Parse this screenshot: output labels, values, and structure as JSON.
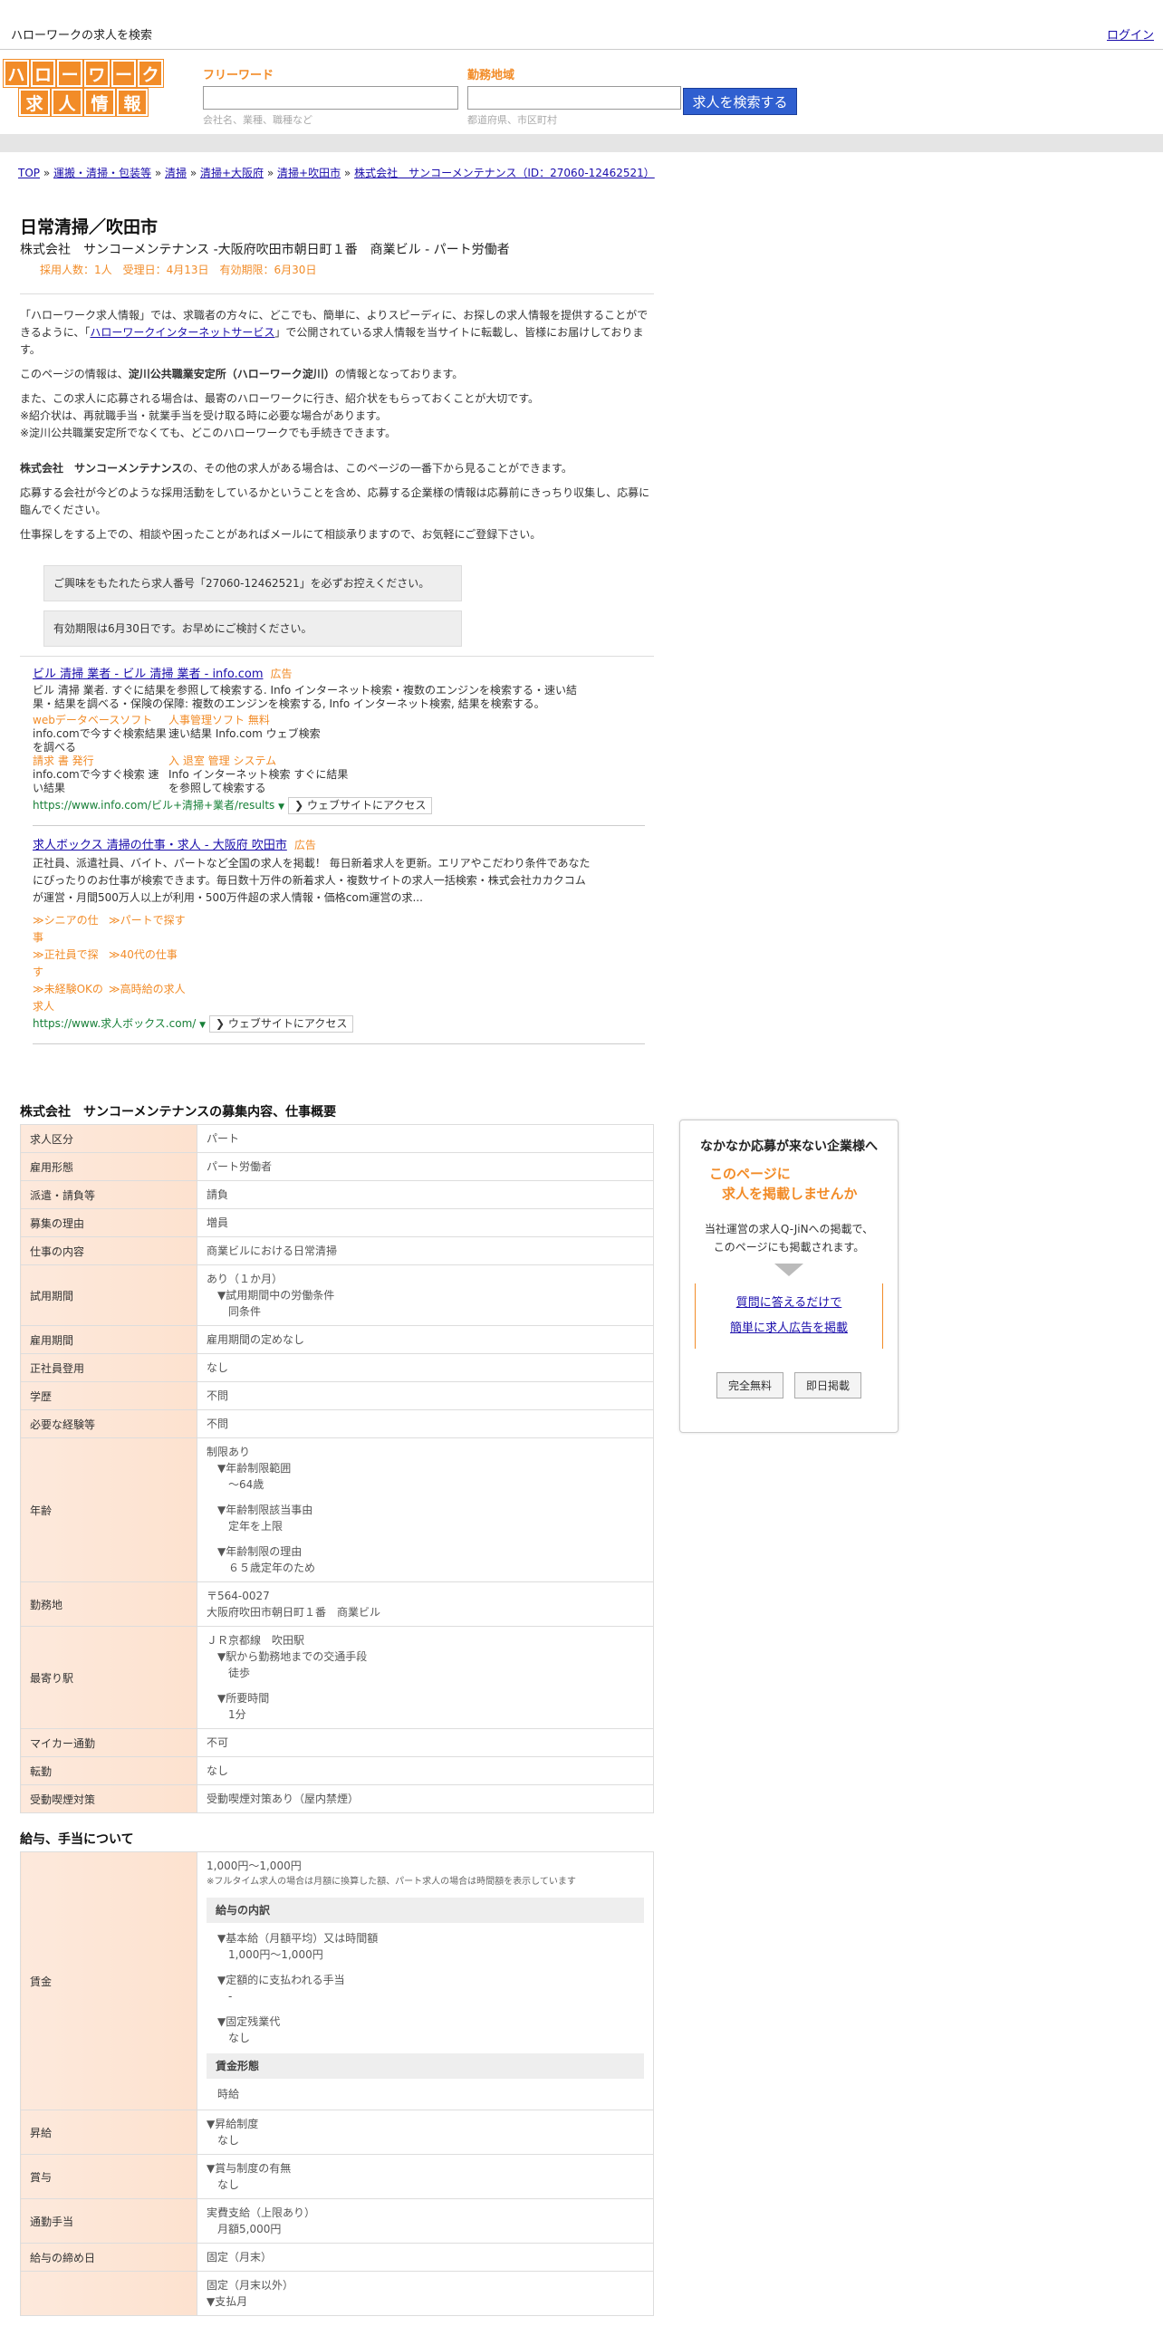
{
  "topbar": {
    "site_title": "ハローワークの求人を検索",
    "login": "ログイン"
  },
  "logo": {
    "row1": [
      "ハ",
      "ロ",
      "ー",
      "ワ",
      "ー",
      "ク"
    ],
    "row2": [
      "求",
      "人",
      "情",
      "報"
    ]
  },
  "search": {
    "freeword_label": "フリーワード",
    "freeword_hint": "会社名、業種、職種など",
    "area_label": "勤務地域",
    "area_hint": "都道府県、市区町村",
    "button": "求人を検索する"
  },
  "breadcrumb": [
    "TOP",
    "運搬・清掃・包装等",
    "清掃",
    "清掃+大阪府",
    "清掃+吹田市",
    "株式会社　サンコーメンテナンス（ID：27060-12462521）"
  ],
  "job": {
    "title": "日常清掃／吹田市",
    "company_line": "株式会社　サンコーメンテナンス -大阪府吹田市朝日町１番　商業ビル - パート労働者",
    "meta": "採用人数：1人　受理日：4月13日　有効期限：6月30日"
  },
  "intro": {
    "p1_a": "「ハローワーク求人情報」では、求職者の方々に、どこでも、簡単に、よりスピーディに、お探しの求人情報を提供することができるように、「",
    "p1_link": "ハローワークインターネットサービス",
    "p1_b": "」で公開されている求人情報を当サイトに転載し、皆様にお届けしております。",
    "p2_a": "このページの情報は、",
    "p2_bold": "淀川公共職業安定所（ハローワーク淀川）",
    "p2_b": "の情報となっております。",
    "p3": [
      "また、この求人に応募される場合は、最寄のハローワークに行き、紹介状をもらっておくことが大切です。",
      "※紹介状は、再就職手当・就業手当を受け取る時に必要な場合があります。",
      "※淀川公共職業安定所でなくても、どこのハローワークでも手続きできます。"
    ],
    "p4_bold": "株式会社　サンコーメンテナンス",
    "p4_b": "の、その他の求人がある場合は、このページの一番下から見ることができます。",
    "p5": "応募する会社が今どのような採用活動をしているかということを含め、応募する企業様の情報は応募前にきっちり収集し、応募に臨んでください。",
    "p6": "仕事探しをする上での、相談や困ったことがあればメールにて相談承りますので、お気軽にご登録下さい。",
    "box1": "ご興味をもたれたら求人番号「27060-12462521」を必ずお控えください。",
    "box2": "有効期限は6月30日です。お早めにご検討ください。"
  },
  "ads": [
    {
      "title": "ビル 清掃 業者 - ビル 清掃 業者 - info.com",
      "badge": "広告",
      "body": "ビル 清掃 業者. すぐに結果を参照して検索する. Info インターネット検索・複数のエンジンを検索する・速い結果・結果を調べる・保険の保障: 複数のエンジンを検索する, Info インターネット検索, 結果を検索する。",
      "links": [
        {
          "title": "webデータベースソフト",
          "desc": "info.comで今すぐ検索結果を調べる"
        },
        {
          "title": "人事管理ソフト 無料",
          "desc": "速い結果 Info.com ウェブ検索"
        },
        {
          "title": "請求 書 発行",
          "desc": "info.comで今すぐ検索 速い結果"
        },
        {
          "title": "入 退室 管理 システム",
          "desc": "Info インターネット検索 すぐに結果を参照して検索する"
        }
      ],
      "url": "https://www.info.com/ビル+清掃+業者/results",
      "visit": "ウェブサイトにアクセス"
    },
    {
      "title": "求人ボックス 清掃の仕事・求人 - 大阪府 吹田市",
      "badge": "広告",
      "body": "正社員、派遣社員、バイト、パートなど全国の求人を掲載！ 毎日新着求人を更新。エリアやこだわり条件であなたにぴったりのお仕事が検索できます。毎日数十万件の新着求人・複数サイトの求人一括検索・株式会社カカクコムが運営・月間500万人以上が利用・500万件超の求人情報・価格com運営の求...",
      "links": [
        {
          "title": "≫シニアの仕事",
          "desc": ""
        },
        {
          "title": "≫パートで探す",
          "desc": ""
        },
        {
          "title": "≫正社員で探す",
          "desc": ""
        },
        {
          "title": "≫40代の仕事",
          "desc": ""
        },
        {
          "title": "≫未経験OKの求人",
          "desc": ""
        },
        {
          "title": "≫高時給の求人",
          "desc": ""
        }
      ],
      "url": "https://www.求人ボックス.com/",
      "visit": "ウェブサイトにアクセス"
    }
  ],
  "overview": {
    "title": "株式会社　サンコーメンテナンスの募集内容、仕事概要",
    "rows": [
      {
        "k": "求人区分",
        "v": [
          "パート"
        ]
      },
      {
        "k": "雇用形態",
        "v": [
          "パート労働者"
        ]
      },
      {
        "k": "派遣・請負等",
        "v": [
          "請負"
        ]
      },
      {
        "k": "募集の理由",
        "v": [
          "増員"
        ]
      },
      {
        "k": "仕事の内容",
        "v": [
          "商業ビルにおける日常清掃"
        ]
      },
      {
        "k": "試用期間",
        "v": [
          "あり（１か月）",
          "▼試用期間中の労働条件",
          "同条件"
        ]
      },
      {
        "k": "雇用期間",
        "v": [
          "雇用期間の定めなし"
        ]
      },
      {
        "k": "正社員登用",
        "v": [
          "なし"
        ]
      },
      {
        "k": "学歴",
        "v": [
          "不問"
        ]
      },
      {
        "k": "必要な経験等",
        "v": [
          "不問"
        ]
      },
      {
        "k": "年齢",
        "v": [
          "制限あり",
          "▼年齢制限範囲",
          "〜64歳",
          "",
          "▼年齢制限該当事由",
          "定年を上限",
          "",
          "▼年齢制限の理由",
          "６５歳定年のため"
        ]
      },
      {
        "k": "勤務地",
        "v": [
          "〒564-0027",
          "大阪府吹田市朝日町１番　商業ビル"
        ]
      },
      {
        "k": "最寄り駅",
        "v": [
          "ＪＲ京都線　吹田駅",
          "▼駅から勤務地までの交通手段",
          "徒歩",
          "",
          "▼所要時間",
          "1分"
        ]
      },
      {
        "k": "マイカー通勤",
        "v": [
          "不可"
        ]
      },
      {
        "k": "転勤",
        "v": [
          "なし"
        ]
      },
      {
        "k": "受動喫煙対策",
        "v": [
          "受動喫煙対策あり（屋内禁煙）"
        ]
      }
    ]
  },
  "salary": {
    "title": "給与、手当について",
    "wage_label": "賃金",
    "wage_main": "1,000円〜1,000円",
    "wage_note": "※フルタイム求人の場合は月額に換算した額、パート求人の場合は時間額を表示しています",
    "breakdown_head": "給与の内訳",
    "breakdown": [
      "▼基本給（月額平均）又は時間額",
      "1,000円〜1,000円",
      "",
      "▼定額的に支払われる手当",
      "-",
      "",
      "▼固定残業代",
      "なし"
    ],
    "form_head": "賃金形態",
    "form_val": "時給",
    "rows": [
      {
        "k": "昇給",
        "v": [
          "▼昇給制度",
          "なし"
        ]
      },
      {
        "k": "賞与",
        "v": [
          "▼賞与制度の有無",
          "なし"
        ]
      },
      {
        "k": "通勤手当",
        "v": [
          "実費支給（上限あり）",
          "月額5,000円"
        ]
      },
      {
        "k": "給与の締め日",
        "v": [
          "固定（月末）"
        ]
      },
      {
        "k": "",
        "v": [
          "固定（月末以外）",
          "▼支払月"
        ]
      }
    ]
  },
  "sidebox": {
    "head": "なかなか応募が来ない企業様へ",
    "orange1": "このページに",
    "orange2": "求人を掲載しませんか",
    "txt1": "当社運営の求人Q-JiNへの掲載で、",
    "txt2": "このページにも掲載されます。",
    "link1": "質問に答えるだけで",
    "link2": "簡単に求人広告を掲載",
    "btn1": "完全無料",
    "btn2": "即日掲載"
  }
}
